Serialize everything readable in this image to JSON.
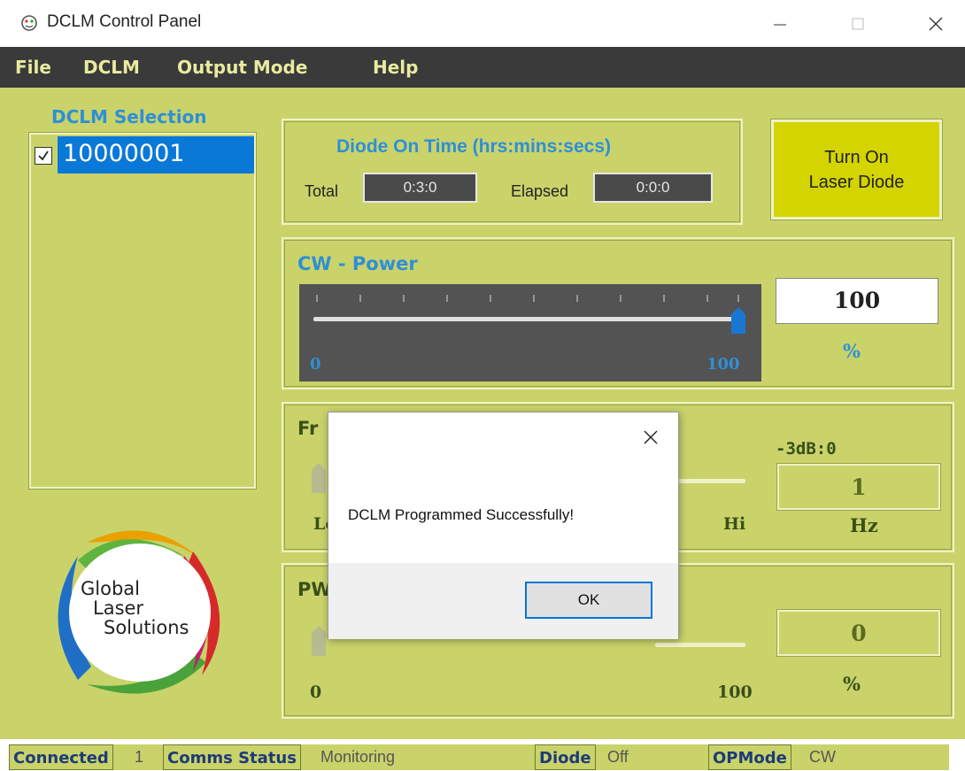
{
  "window": {
    "title": "DCLM Control Panel"
  },
  "menu": {
    "items": [
      "File",
      "DCLM",
      "Output Mode",
      "Help"
    ]
  },
  "selection": {
    "title": "DCLM Selection",
    "items": [
      {
        "label": "10000001",
        "checked": true
      }
    ]
  },
  "logo": {
    "line1": "Global",
    "line2": "Laser",
    "line3": "Solutions"
  },
  "diode_time": {
    "title": "Diode On Time (hrs:mins:secs)",
    "total_label": "Total",
    "total_value": "0:3:0",
    "elapsed_label": "Elapsed",
    "elapsed_value": "0:0:0"
  },
  "laser_button": {
    "line1": "Turn On",
    "line2": "Laser Diode"
  },
  "cw_power": {
    "title": "CW - Power",
    "min_label": "0",
    "max_label": "100",
    "value": "100",
    "unit": "%",
    "level": 1.0
  },
  "frequency": {
    "title": "Fr",
    "lo_label": "Lo",
    "hi_label": "Hi",
    "db_label": "-3dB:0",
    "value": "1",
    "unit": "Hz"
  },
  "pwm": {
    "title": "PW",
    "min_label": "0",
    "max_label": "100",
    "value": "0",
    "unit": "%"
  },
  "status": {
    "connected_label": "Connected",
    "connected_value": "1",
    "comms_label": "Comms Status",
    "comms_value": "Monitoring",
    "diode_label": "Diode",
    "diode_value": "Off",
    "opmode_label": "OPMode",
    "opmode_value": "CW"
  },
  "dialog": {
    "message": "DCLM Programmed Successfully!",
    "ok_label": "OK"
  },
  "colors": {
    "panel": "#c9d36a",
    "menubar": "#3a3a3a",
    "accent_blue": "#2f8fd6",
    "laser_button": "#d3d400"
  }
}
